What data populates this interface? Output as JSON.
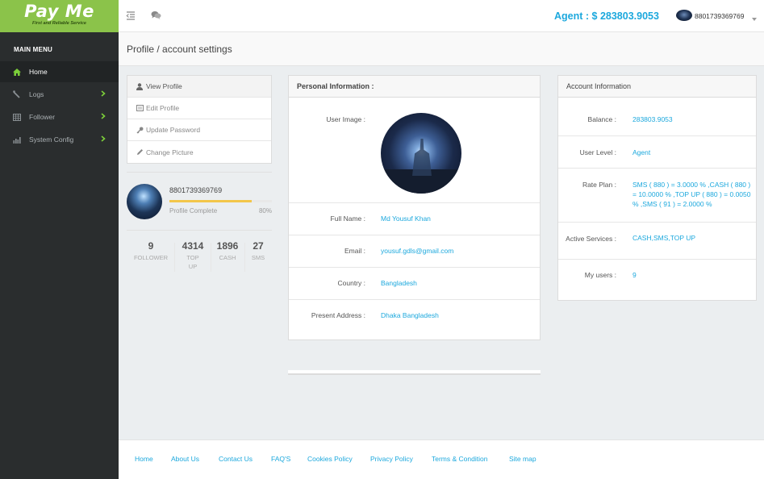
{
  "brand": {
    "name": "Pay Me",
    "tagline": "First and Reliable Service"
  },
  "sidebar": {
    "title": "MAIN MENU",
    "items": [
      {
        "label": "Home",
        "icon": "home-icon"
      },
      {
        "label": "Logs",
        "icon": "logs-icon"
      },
      {
        "label": "Follower",
        "icon": "table-icon"
      },
      {
        "label": "System Config",
        "icon": "chart-icon"
      }
    ]
  },
  "topbar": {
    "agent_balance": "Agent : $ 283803.9053",
    "user_name": "8801739369769"
  },
  "page": {
    "title": "Profile / account settings"
  },
  "profile_nav": {
    "items": [
      {
        "label": "View Profile"
      },
      {
        "label": "Edit Profile"
      },
      {
        "label": "Update Password"
      },
      {
        "label": "Change Picture"
      }
    ]
  },
  "profile_summary": {
    "name": "8801739369769",
    "complete_label": "Profile Complete",
    "complete_pct": "80%",
    "complete_value": 0.8
  },
  "stats": [
    {
      "value": "9",
      "label": "FOLLOWER"
    },
    {
      "value": "4314",
      "label": "TOP UP"
    },
    {
      "value": "1896",
      "label": "CASH"
    },
    {
      "value": "27",
      "label": "SMS"
    }
  ],
  "personal_info": {
    "title": "Personal Information :",
    "image_label": "User Image :",
    "fields": [
      {
        "label": "Full Name :",
        "value": "Md Yousuf Khan"
      },
      {
        "label": "Email :",
        "value": "yousuf.gdls@gmail.com"
      },
      {
        "label": "Country :",
        "value": "Bangladesh"
      },
      {
        "label": "Present Address :",
        "value": "Dhaka Bangladesh"
      }
    ]
  },
  "account_info": {
    "title": "Account Information",
    "balance_label": "Balance :",
    "balance_value": "283803.9053",
    "level_label": "User Level :",
    "level_value": "Agent",
    "rate_label": "Rate Plan :",
    "rate_value": "SMS ( 880 ) = 3.0000 % ,CASH ( 880 ) = 10.0000 % ,TOP UP ( 880 ) = 0.0050 % ,SMS ( 91 ) = 2.0000 %",
    "services_label": "Active Services :",
    "services_value": "CASH,SMS,TOP UP",
    "users_label": "My users :",
    "users_value": "9"
  },
  "footer": {
    "links": [
      "Home",
      "About Us",
      "Contact Us",
      "FAQ'S",
      "Cookies Policy",
      "Privacy Policy",
      "Terms & Condition",
      "Site map"
    ]
  },
  "colors": {
    "accent": "#1ca8dd",
    "brand_green": "#8bc34a",
    "sidebar_bg": "#2a2d2e",
    "progress": "#f3c64a",
    "menu_arrow": "#8bc34a"
  }
}
